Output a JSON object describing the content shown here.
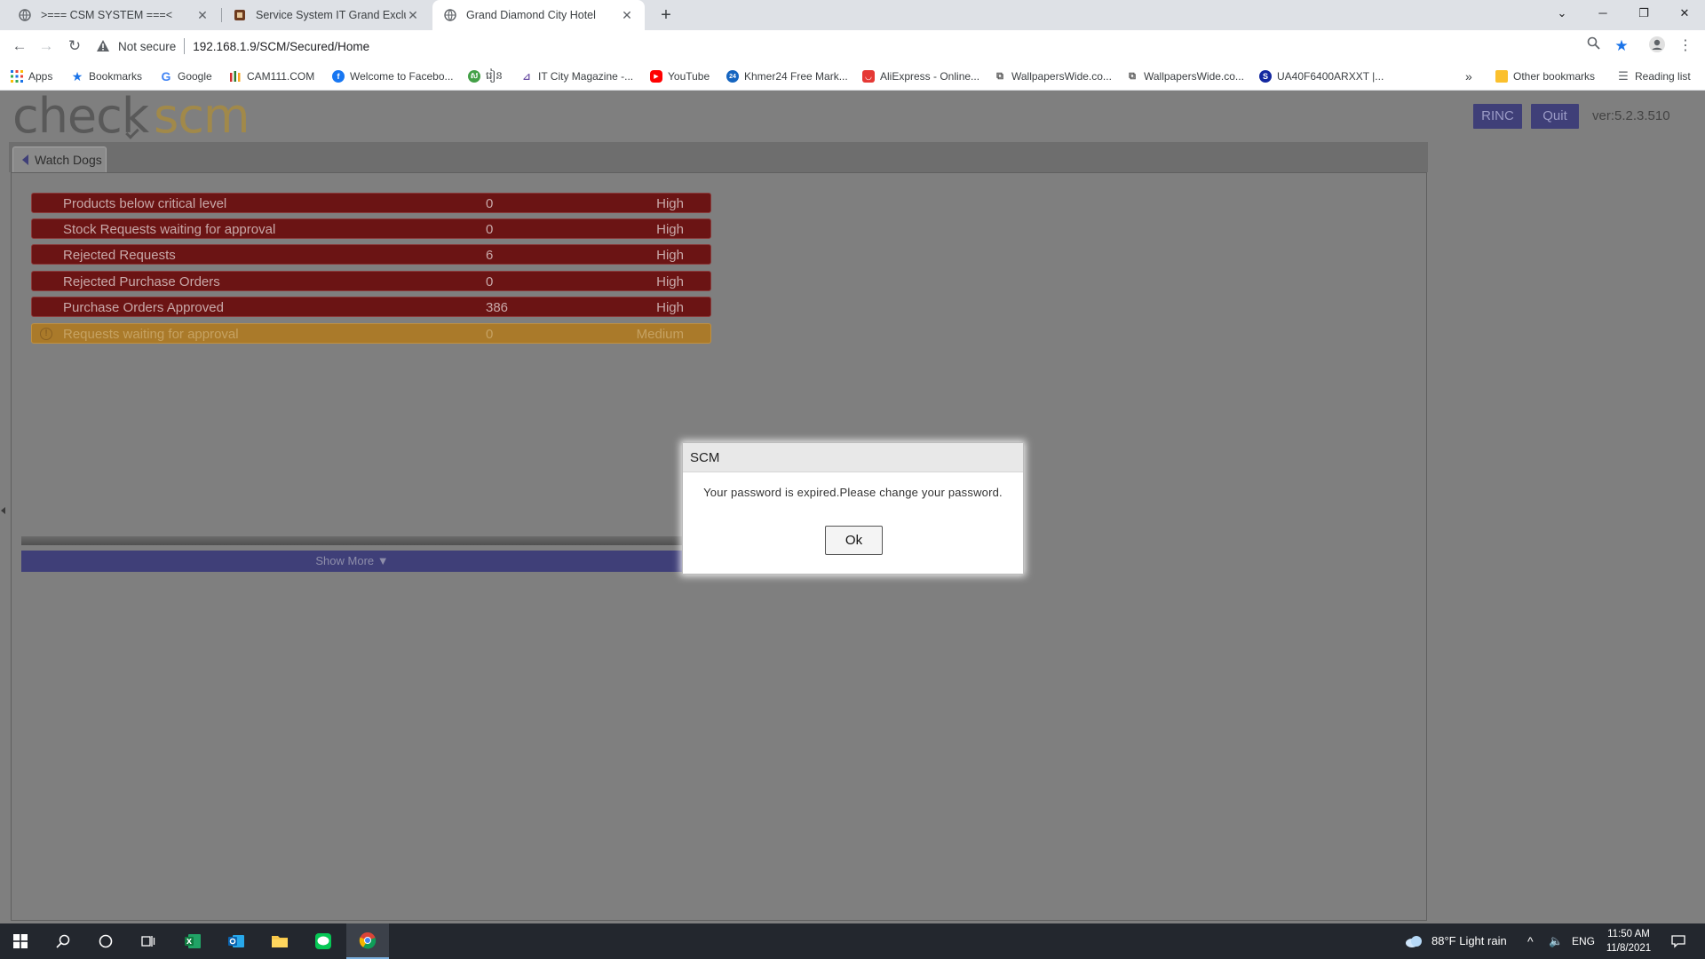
{
  "browser": {
    "tabs": [
      {
        "title": ">=== CSM SYSTEM ===<",
        "icon": "globe-icon"
      },
      {
        "title": "Service System IT Grand Exclusive",
        "icon": "hotel-favicon"
      },
      {
        "title": "Grand Diamond City Hotel",
        "icon": "globe-icon"
      }
    ],
    "omnibox": {
      "security": "Not secure",
      "url": "192.168.1.9/SCM/Secured/Home"
    },
    "bookmarks": [
      {
        "label": "Apps",
        "icon": "apps-grid-icon",
        "color": "#1a73e8"
      },
      {
        "label": "Bookmarks",
        "icon": "star-icon",
        "color": "#1a73e8"
      },
      {
        "label": "Google",
        "icon": "google-icon",
        "color": "#4285f4"
      },
      {
        "label": "CAM111.COM",
        "icon": "cam111-icon",
        "color": "#2e7d32"
      },
      {
        "label": "Welcome to Facebo...",
        "icon": "facebook-icon",
        "color": "#1877f2"
      },
      {
        "label": "រៀន",
        "icon": "khmer-site-icon",
        "color": "#43a047"
      },
      {
        "label": "IT City Magazine -...",
        "icon": "itcity-icon",
        "color": "#6a4fa3"
      },
      {
        "label": "YouTube",
        "icon": "youtube-icon",
        "color": "#ff0000"
      },
      {
        "label": "Khmer24 Free Mark...",
        "icon": "khmer24-icon",
        "color": "#1565c0"
      },
      {
        "label": "AliExpress - Online...",
        "icon": "aliexpress-icon",
        "color": "#e53935"
      },
      {
        "label": "WallpapersWide.co...",
        "icon": "wallpaperswide-icon",
        "color": "#555555"
      },
      {
        "label": "WallpapersWide.co...",
        "icon": "wallpaperswide-icon",
        "color": "#555555"
      },
      {
        "label": "UA40F6400ARXXT |...",
        "icon": "samsung-s-icon",
        "color": "#1428a0"
      }
    ],
    "other_bookmarks": "Other bookmarks",
    "reading_list": "Reading list",
    "overflow": "»"
  },
  "app": {
    "logo": {
      "part1": "check",
      "part2": "scm"
    },
    "buttons": {
      "rinc": "RINC",
      "quit": "Quit"
    },
    "version": "ver:5.2.3.510",
    "panel_tab": "Watch Dogs",
    "watchdogs": [
      {
        "label": "Products below critical level",
        "count": "0",
        "level": "High"
      },
      {
        "label": "Stock Requests waiting for approval",
        "count": "0",
        "level": "High"
      },
      {
        "label": "Rejected Requests",
        "count": "6",
        "level": "High"
      },
      {
        "label": "Rejected Purchase Orders",
        "count": "0",
        "level": "High"
      },
      {
        "label": "Purchase Orders Approved",
        "count": "386",
        "level": "High"
      },
      {
        "label": "Requests waiting for approval",
        "count": "0",
        "level": "Medium"
      }
    ],
    "show_more": "Show More ▼"
  },
  "dialog": {
    "title": "SCM",
    "message": "Your password is expired.Please change your password.",
    "ok": "Ok"
  },
  "taskbar": {
    "apps": [
      "start-icon",
      "search-icon",
      "cortana-icon",
      "task-view-icon",
      "excel-icon",
      "outlook-icon",
      "file-explorer-icon",
      "line-icon",
      "chrome-icon"
    ],
    "weather": "88°F  Light rain",
    "lang": "ENG",
    "time": "11:50 AM",
    "date": "11/8/2021"
  },
  "colors": {
    "high_row": "#6b1414",
    "medium_row": "#aa7a2a",
    "app_button": "#3f3f78",
    "logo_scm": "#a1894a"
  }
}
